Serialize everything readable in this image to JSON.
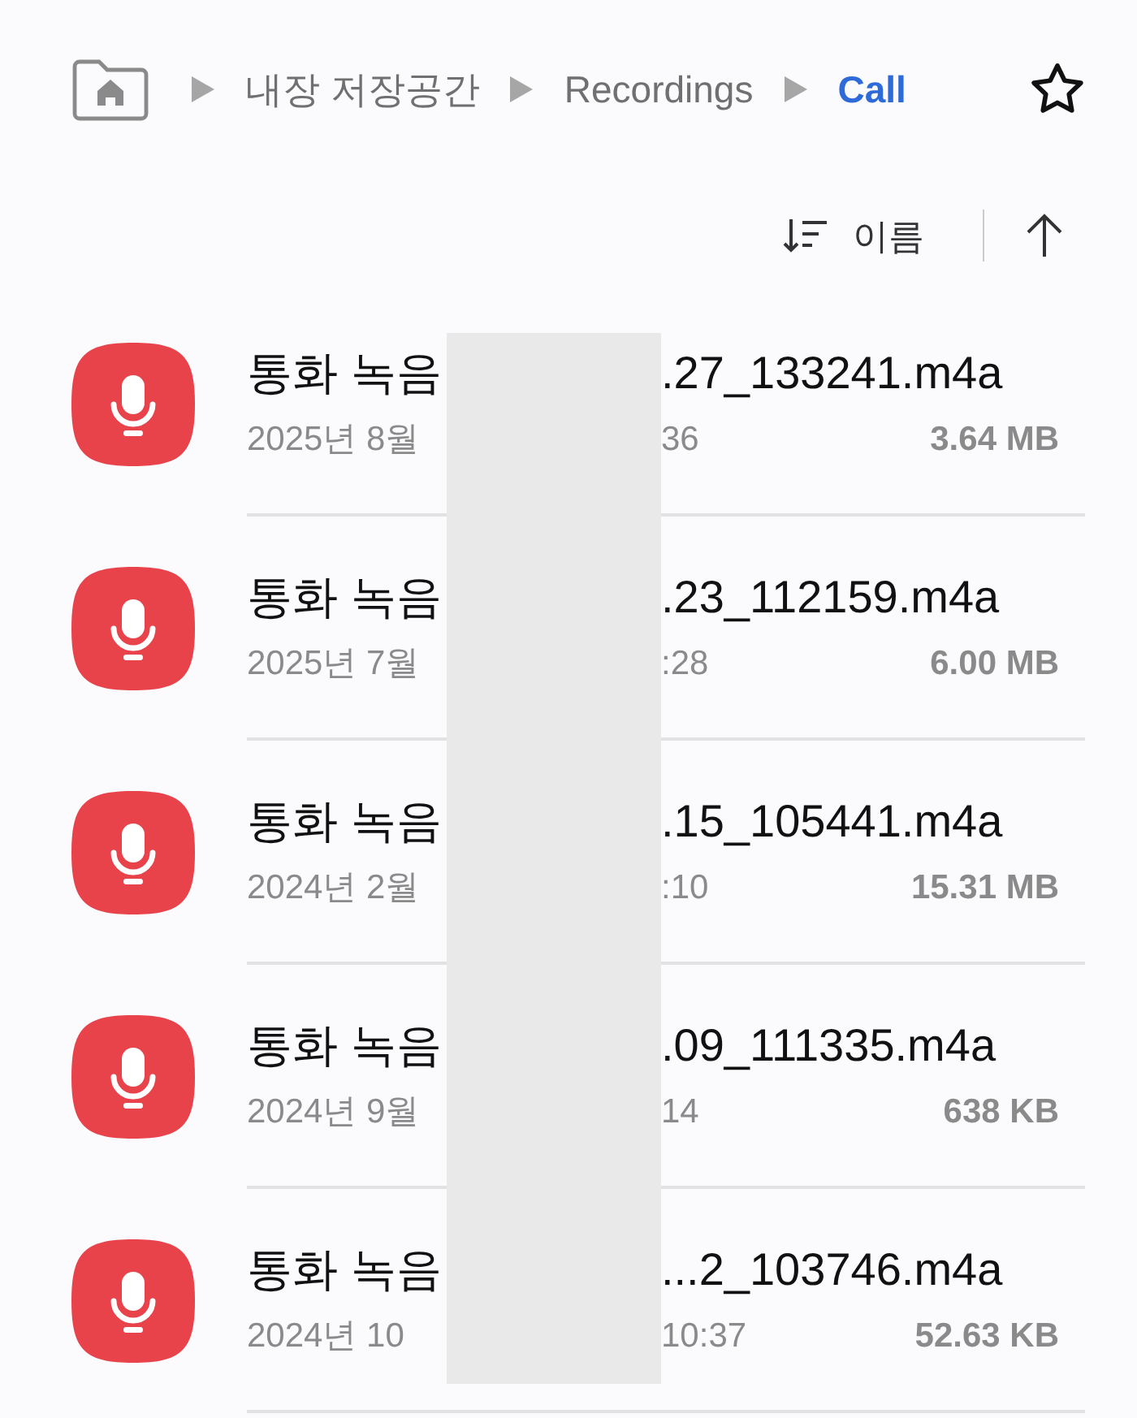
{
  "breadcrumb": [
    {
      "label": "내장 저장공간",
      "current": false
    },
    {
      "label": "Recordings",
      "current": false
    },
    {
      "label": "Call",
      "current": true
    }
  ],
  "sort": {
    "label": "이름"
  },
  "files": [
    {
      "name_start": "통화 녹음",
      "name_end": ".27_133241.m4a",
      "date_start": "2025년 8월",
      "date_end": "36",
      "size": "3.64 MB"
    },
    {
      "name_start": "통화 녹음",
      "name_end": ".23_112159.m4a",
      "date_start": "2025년 7월",
      "date_end": ":28",
      "size": "6.00 MB"
    },
    {
      "name_start": "통화 녹음",
      "name_end": ".15_105441.m4a",
      "date_start": "2024년 2월",
      "date_end": ":10",
      "size": "15.31 MB"
    },
    {
      "name_start": "통화 녹음",
      "name_end": ".09_111335.m4a",
      "date_start": "2024년 9월",
      "date_end": "14",
      "size": "638 KB"
    },
    {
      "name_start": "통화 녹음",
      "name_end": "...2_103746.m4a",
      "date_start": "2024년 10",
      "date_end": "10:37",
      "size": "52.63 KB"
    }
  ]
}
